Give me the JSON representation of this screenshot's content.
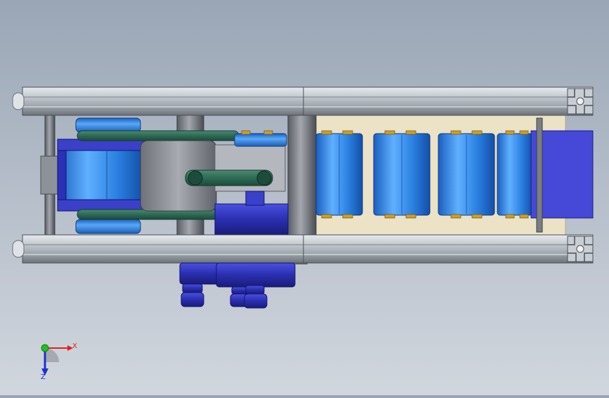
{
  "view": {
    "background_top": "#9aa6b6",
    "background_bottom": "#d2d7de",
    "model": "conveyor-drive-assembly"
  },
  "colors": {
    "frame": "#b8c0c8",
    "roller_blue": "#3a8ee8",
    "motor_blue": "#2a2fb0",
    "belt_green": "#2e6a55",
    "gray_steel": "#8a8e94",
    "bed_tan": "#e8dcc0",
    "brass": "#c8a030",
    "end_block": "#4648d8"
  },
  "triad": {
    "x_label": "X",
    "z_label": "Z",
    "x_color": "#e02020",
    "z_color": "#2030d0",
    "origin_color": "#20c020"
  }
}
